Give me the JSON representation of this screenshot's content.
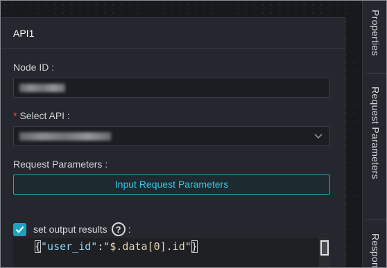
{
  "panel": {
    "title": "API1",
    "node_id": {
      "label": "Node ID :",
      "value_redacted": true
    },
    "select_api": {
      "required_mark": "*",
      "label": "Select API :",
      "value_redacted": true
    },
    "request_parameters": {
      "label": "Request Parameters :",
      "button_label": "Input Request Parameters"
    },
    "output": {
      "checked": true,
      "label": "set output results",
      "help_symbol": "?",
      "colon": ":",
      "code": {
        "open_brace": "{",
        "key": "\"user_id\"",
        "sep": ":",
        "value": "\"$.data[0].id\"",
        "close_brace": "}"
      }
    }
  },
  "side_tabs": [
    {
      "label": "Properties"
    },
    {
      "label": "Request Parameters"
    },
    {
      "label": "Response"
    }
  ],
  "colors": {
    "accent": "#19a7c2",
    "panel_bg": "#24272d",
    "required": "#ff4d4f"
  }
}
